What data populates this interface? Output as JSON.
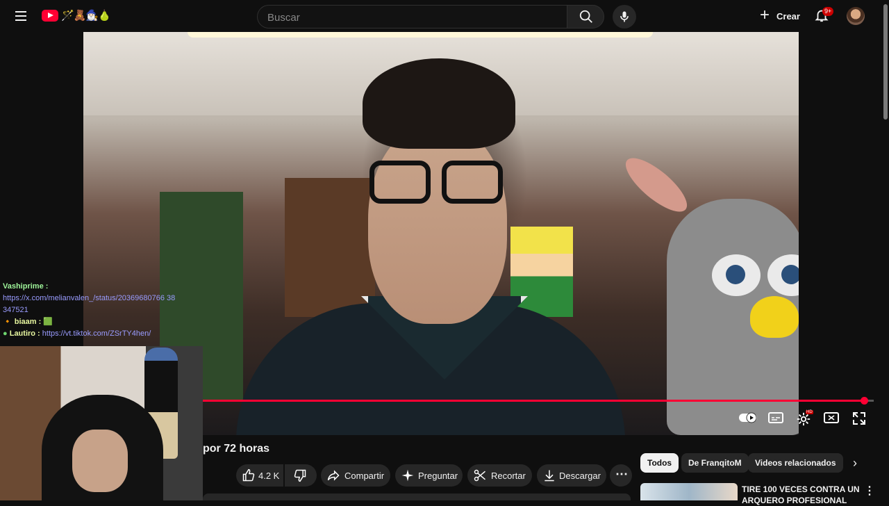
{
  "header": {
    "search_placeholder": "Buscar",
    "create_label": "Crear",
    "notification_badge": "9+",
    "logo_emojis": "🪄🧸🧙🏻‍♂️🍐"
  },
  "player": {
    "progress_fraction": 0.985
  },
  "chat": {
    "messages": [
      {
        "user": "Vashiprime :",
        "text": "https://x.com/melianvalen_/status/2036968076638347521",
        "text_line1": "https://x.com/melianvalen_/status/20369680766 38",
        "text_line2": "347521"
      },
      {
        "user": "biaam :",
        "text": "🟩"
      },
      {
        "user": "Lautiro :",
        "text": "https://vt.tiktok.com/ZSrTY4hen/"
      }
    ]
  },
  "video": {
    "title_fragment": "por 72 horas",
    "like_count": "4.2 K",
    "share_label": "Compartir",
    "ask_label": "Preguntar",
    "clip_label": "Recortar",
    "download_label": "Descargar"
  },
  "sidebar": {
    "chips": [
      "Todos",
      "De FranqitoM",
      "Videos relacionados"
    ],
    "rec_title": "TIRE 100 VECES CONTRA UN ARQUERO PROFESIONAL"
  },
  "colors": {
    "accent": "#ff0033",
    "background": "#0f0f0f",
    "chip_bg": "#272727"
  }
}
